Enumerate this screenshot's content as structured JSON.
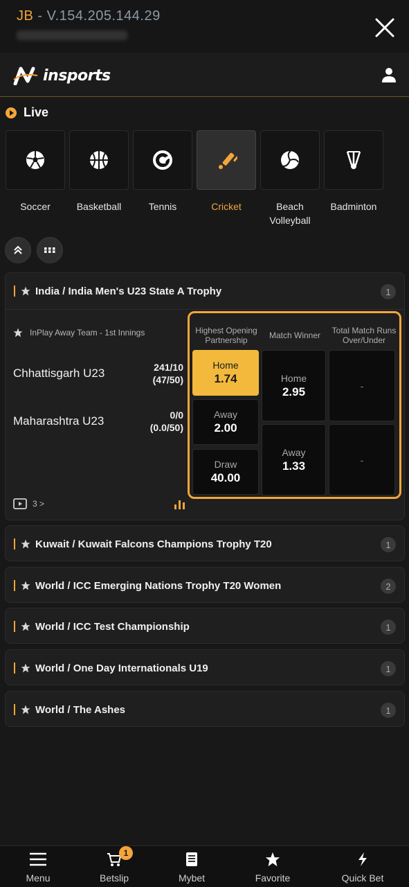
{
  "topbar": {
    "prefix": "JB",
    "version": " - V.154.205.144.29"
  },
  "brand": {
    "logo_text": "insports"
  },
  "live_label": "Live",
  "sports": [
    {
      "label": "Soccer",
      "icon": "soccer-ball-icon",
      "active": false
    },
    {
      "label": "Basketball",
      "icon": "basketball-icon",
      "active": false
    },
    {
      "label": "Tennis",
      "icon": "tennis-ball-icon",
      "active": false
    },
    {
      "label": "Cricket",
      "icon": "cricket-bat-icon",
      "active": true
    },
    {
      "label": "Beach Volleyball",
      "icon": "volleyball-icon",
      "active": false
    },
    {
      "label": "Badminton",
      "icon": "shuttlecock-icon",
      "active": false
    }
  ],
  "leagues": [
    {
      "name": "India / India Men's U23 State A Trophy",
      "count": "1"
    },
    {
      "name": "Kuwait / Kuwait Falcons Champions Trophy T20",
      "count": "1"
    },
    {
      "name": "World / ICC Emerging Nations Trophy T20 Women",
      "count": "2"
    },
    {
      "name": "World / ICC Test Championship",
      "count": "1"
    },
    {
      "name": "World / One Day Internationals U19",
      "count": "1"
    },
    {
      "name": "World / The Ashes",
      "count": "1"
    }
  ],
  "match": {
    "status": "InPlay Away Team - 1st Innings",
    "home_team": "Chhattisgarh U23",
    "home_score": "241/10",
    "home_overs": "(47/50)",
    "away_team": "Maharashtra U23",
    "away_score": "0/0",
    "away_overs": "(0.0/50)",
    "stats_count": "3 >"
  },
  "markets": {
    "headers": [
      "Highest Opening Partnership",
      "Match Winner",
      "Total Match Runs Over/Under"
    ],
    "partnership": [
      {
        "label": "Home",
        "value": "1.74",
        "selected": true
      },
      {
        "label": "Away",
        "value": "2.00",
        "selected": false
      },
      {
        "label": "Draw",
        "value": "40.00",
        "selected": false
      }
    ],
    "winner": [
      {
        "label": "Home",
        "value": "2.95"
      },
      {
        "label": "Away",
        "value": "1.33"
      }
    ],
    "totals": [
      "-",
      "-"
    ]
  },
  "nav": [
    {
      "label": "Menu",
      "icon": "menu-icon"
    },
    {
      "label": "Betslip",
      "icon": "cart-icon",
      "badge": "1"
    },
    {
      "label": "Mybet",
      "icon": "receipt-icon"
    },
    {
      "label": "Favorite",
      "icon": "star-icon"
    },
    {
      "label": "Quick Bet",
      "icon": "lightning-icon"
    }
  ],
  "colors": {
    "accent": "#f3a53b",
    "background": "#181818",
    "selected_odd": "#f3b93c"
  }
}
